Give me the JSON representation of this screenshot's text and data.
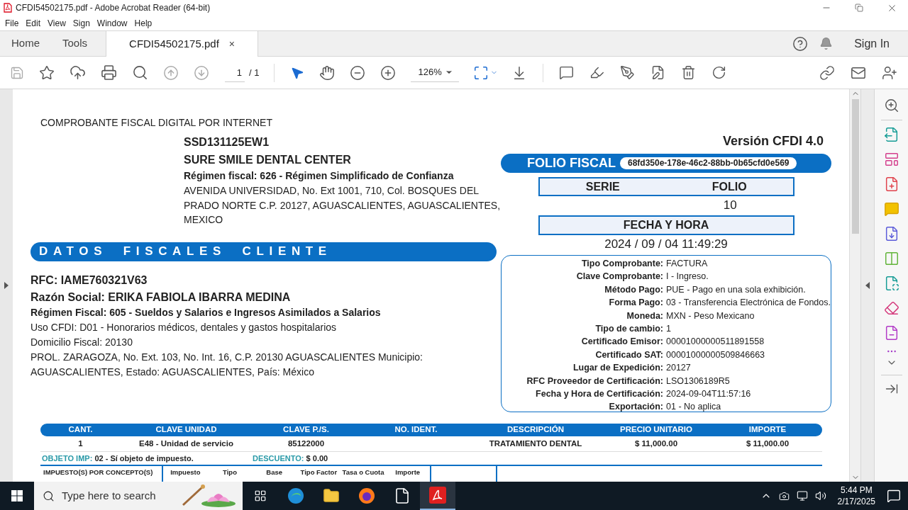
{
  "window": {
    "title": "CFDI54502175.pdf - Adobe Acrobat Reader (64-bit)"
  },
  "menu": [
    "File",
    "Edit",
    "View",
    "Sign",
    "Window",
    "Help"
  ],
  "tabs": [
    {
      "label": "Home",
      "selected": false
    },
    {
      "label": "Tools",
      "selected": false
    },
    {
      "label": "CFDI54502175.pdf",
      "selected": true,
      "close": "×"
    }
  ],
  "sign_in": "Sign In",
  "toolbar": {
    "page": "1",
    "page_total": "/ 1",
    "zoom": "126%"
  },
  "document": {
    "heading": "COMPROBANTE FISCAL DIGITAL POR INTERNET",
    "issuer": {
      "rfc": "SSD131125EW1",
      "name": "SURE SMILE DENTAL CENTER",
      "regimen": "Régimen fiscal: 626 - Régimen Simplificado de Confianza",
      "address": "AVENIDA UNIVERSIDAD, No. Ext 1001, 710, Col. BOSQUES DEL PRADO NORTE C.P. 20127, AGUASCALIENTES, AGUASCALIENTES, MEXICO"
    },
    "client_title": "DATOS FISCALES CLIENTE",
    "client": {
      "rfc": "RFC: IAME760321V63",
      "razon_social": "Razón Social: ERIKA FABIOLA IBARRA MEDINA",
      "regimen": "Régimen Fiscal: 605 - Sueldos y Salarios e Ingresos Asimilados a Salarios",
      "uso": "Uso CFDI: D01 - Honorarios médicos, dentales y gastos hospitalarios",
      "domicilio": "Domicilio Fiscal: 20130",
      "address": "PROL. ZARAGOZA, No. Ext. 103, No. Int. 16, C.P. 20130 AGUASCALIENTES Municipio: AGUASCALIENTES, Estado: AGUASCALIENTES, País: México"
    },
    "version": "Versión CFDI 4.0",
    "folio_fiscal": {
      "label": "FOLIO FISCAL",
      "value": "68fd350e-178e-46c2-88bb-0b65cfd0e569"
    },
    "serie_folio": {
      "headers": [
        "SERIE",
        "FOLIO"
      ],
      "folio": "10"
    },
    "fecha": {
      "label": "FECHA Y HORA",
      "value": "2024 / 09 / 04 11:49:29"
    },
    "details": [
      {
        "label": "Tipo Comprobante:",
        "value": "FACTURA"
      },
      {
        "label": "Clave Comprobante:",
        "value": "I - Ingreso."
      },
      {
        "label": "Método Pago:",
        "value": "PUE - Pago en una sola exhibición."
      },
      {
        "label": "Forma Pago:",
        "value": "03 - Transferencia Electrónica de Fondos."
      },
      {
        "label": "Moneda:",
        "value": "MXN - Peso Mexicano"
      },
      {
        "label": "Tipo de cambio:",
        "value": "1"
      },
      {
        "label": "Certificado Emisor:",
        "value": "00001000000511891558"
      },
      {
        "label": "Certificado SAT:",
        "value": "00001000000509846663"
      },
      {
        "label": "Lugar de Expedición:",
        "value": "20127"
      },
      {
        "label": "RFC Proveedor de Certificación:",
        "value": "LSO1306189R5"
      },
      {
        "label": "Fecha y Hora de Certificación:",
        "value": "2024-09-04T11:57:16"
      },
      {
        "label": "Exportación:",
        "value": "01 - No aplica"
      }
    ],
    "concepts": {
      "columns": [
        "CANT.",
        "CLAVE UNIDAD",
        "CLAVE P./S.",
        "NO. IDENT.",
        "DESCRIPCIÓN",
        "PRECIO UNITARIO",
        "IMPORTE"
      ],
      "rows": [
        {
          "cells": [
            "1",
            "E48 - Unidad de servicio",
            "85122000",
            "",
            "TRATAMIENTO DENTAL",
            "$ 11,000.00",
            "$ 11,000.00"
          ]
        }
      ],
      "objeto_imp": {
        "label": "OBJETO IMP:",
        "value": "02 - Sí objeto de impuesto."
      },
      "descuento": {
        "label": "DESCUENTO:",
        "value": "$ 0.00"
      }
    },
    "taxes": {
      "label": "IMPUESTO(S) POR CONCEPTO(S)",
      "columns": [
        "Impuesto",
        "Tipo",
        "Base",
        "Tipo Factor",
        "Tasa o Cuota",
        "Importe"
      ]
    }
  },
  "taskbar": {
    "search_placeholder": "Type here to search",
    "time": "5:44 PM",
    "date": "2/17/2025"
  }
}
